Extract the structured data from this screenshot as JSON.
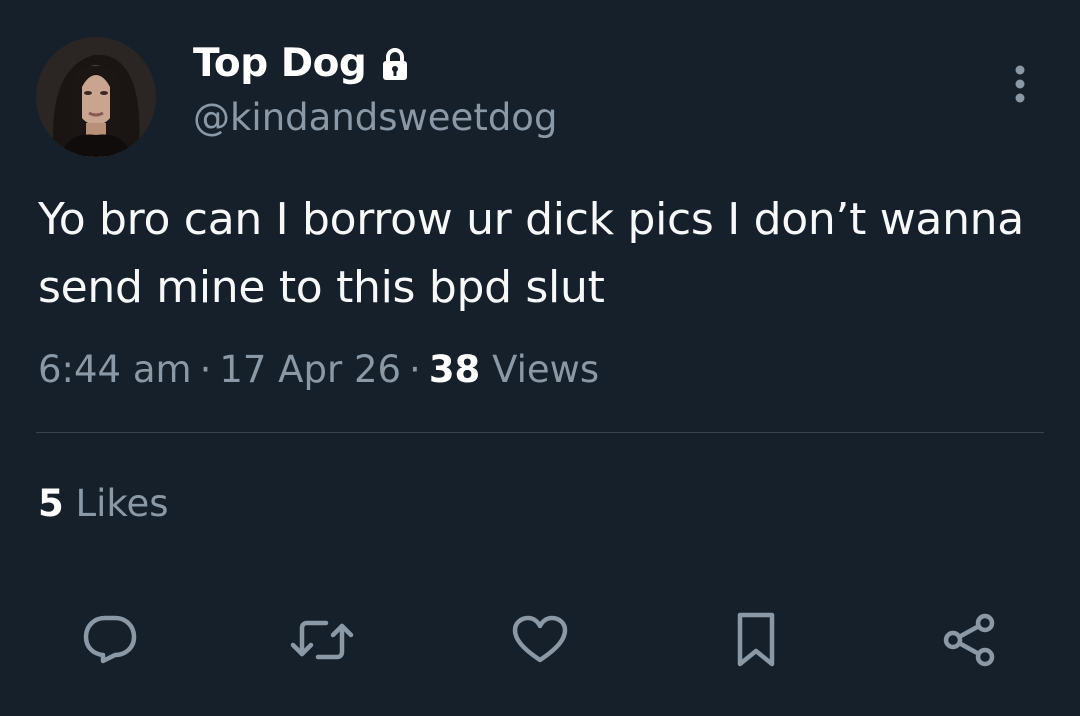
{
  "author": {
    "display_name": "Top Dog",
    "handle": "@kindandsweetdog",
    "avatar_icon": "profile-photo",
    "protected_icon": "lock-icon"
  },
  "tweet": {
    "text": "Yo bro can I borrow ur dick pics I don’t wanna send mine to this bpd slut",
    "time": "6:44 am",
    "separator": "·",
    "date": "17 Apr 26",
    "views_count": "38",
    "views_label": "Views"
  },
  "stats": {
    "likes_count": "5",
    "likes_label": "Likes"
  },
  "actions": [
    {
      "name": "reply",
      "icon": "reply-icon"
    },
    {
      "name": "retweet",
      "icon": "retweet-icon"
    },
    {
      "name": "like",
      "icon": "heart-icon"
    },
    {
      "name": "bookmark",
      "icon": "bookmark-icon"
    },
    {
      "name": "share",
      "icon": "share-icon"
    }
  ],
  "colors": {
    "background": "#15202b",
    "primary_text": "#f7f9f9",
    "secondary_text": "#8b98a5",
    "divider": "#38444d"
  }
}
